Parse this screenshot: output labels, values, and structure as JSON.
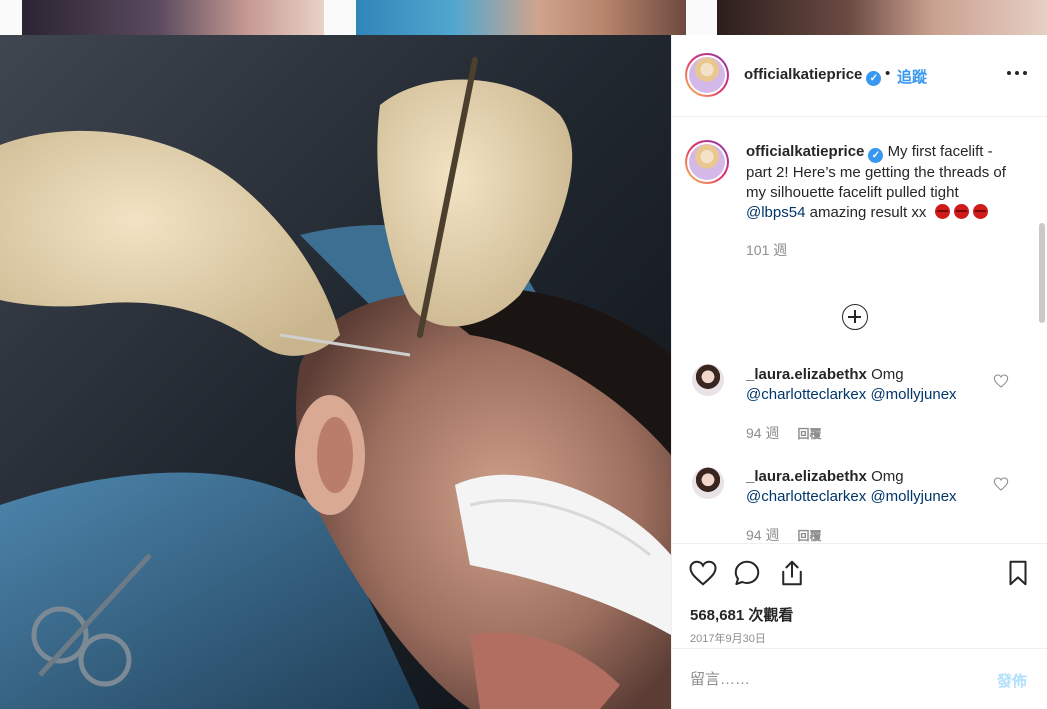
{
  "header": {
    "username": "officialkatieprice",
    "verified_mark": "✓",
    "separator": "•",
    "follow_label": "追蹤"
  },
  "caption": {
    "username": "officialkatieprice",
    "text_1": "My first facelift - part 2! Here’s me getting the threads of my silhouette facelift pulled tight ",
    "mention": "@lbps54",
    "text_2": " amazing result xx",
    "emoji_icons": [
      "kiss-mark-icon",
      "kiss-mark-icon",
      "kiss-mark-icon"
    ],
    "time": "101 週"
  },
  "comments": [
    {
      "username": "_laura.elizabethx",
      "text": "Omg",
      "mention_1": "@charlotteclarkex",
      "mention_2": "@mollyjunex",
      "time": "94 週",
      "reply_label": "回覆"
    },
    {
      "username": "_laura.elizabethx",
      "text": "Omg",
      "mention_1": "@charlotteclarkex",
      "mention_2": "@mollyjunex",
      "time": "94 週",
      "reply_label": "回覆"
    }
  ],
  "stats": {
    "views": "568,681 次觀看",
    "date": "2017年9月30日"
  },
  "comment_box": {
    "placeholder": "留言……",
    "post_label": "發佈"
  },
  "colors": {
    "link_blue": "#3897f0",
    "mention_blue": "#003569",
    "post_disabled": "#b2dffc",
    "muted_gray": "#8e8e8e"
  }
}
